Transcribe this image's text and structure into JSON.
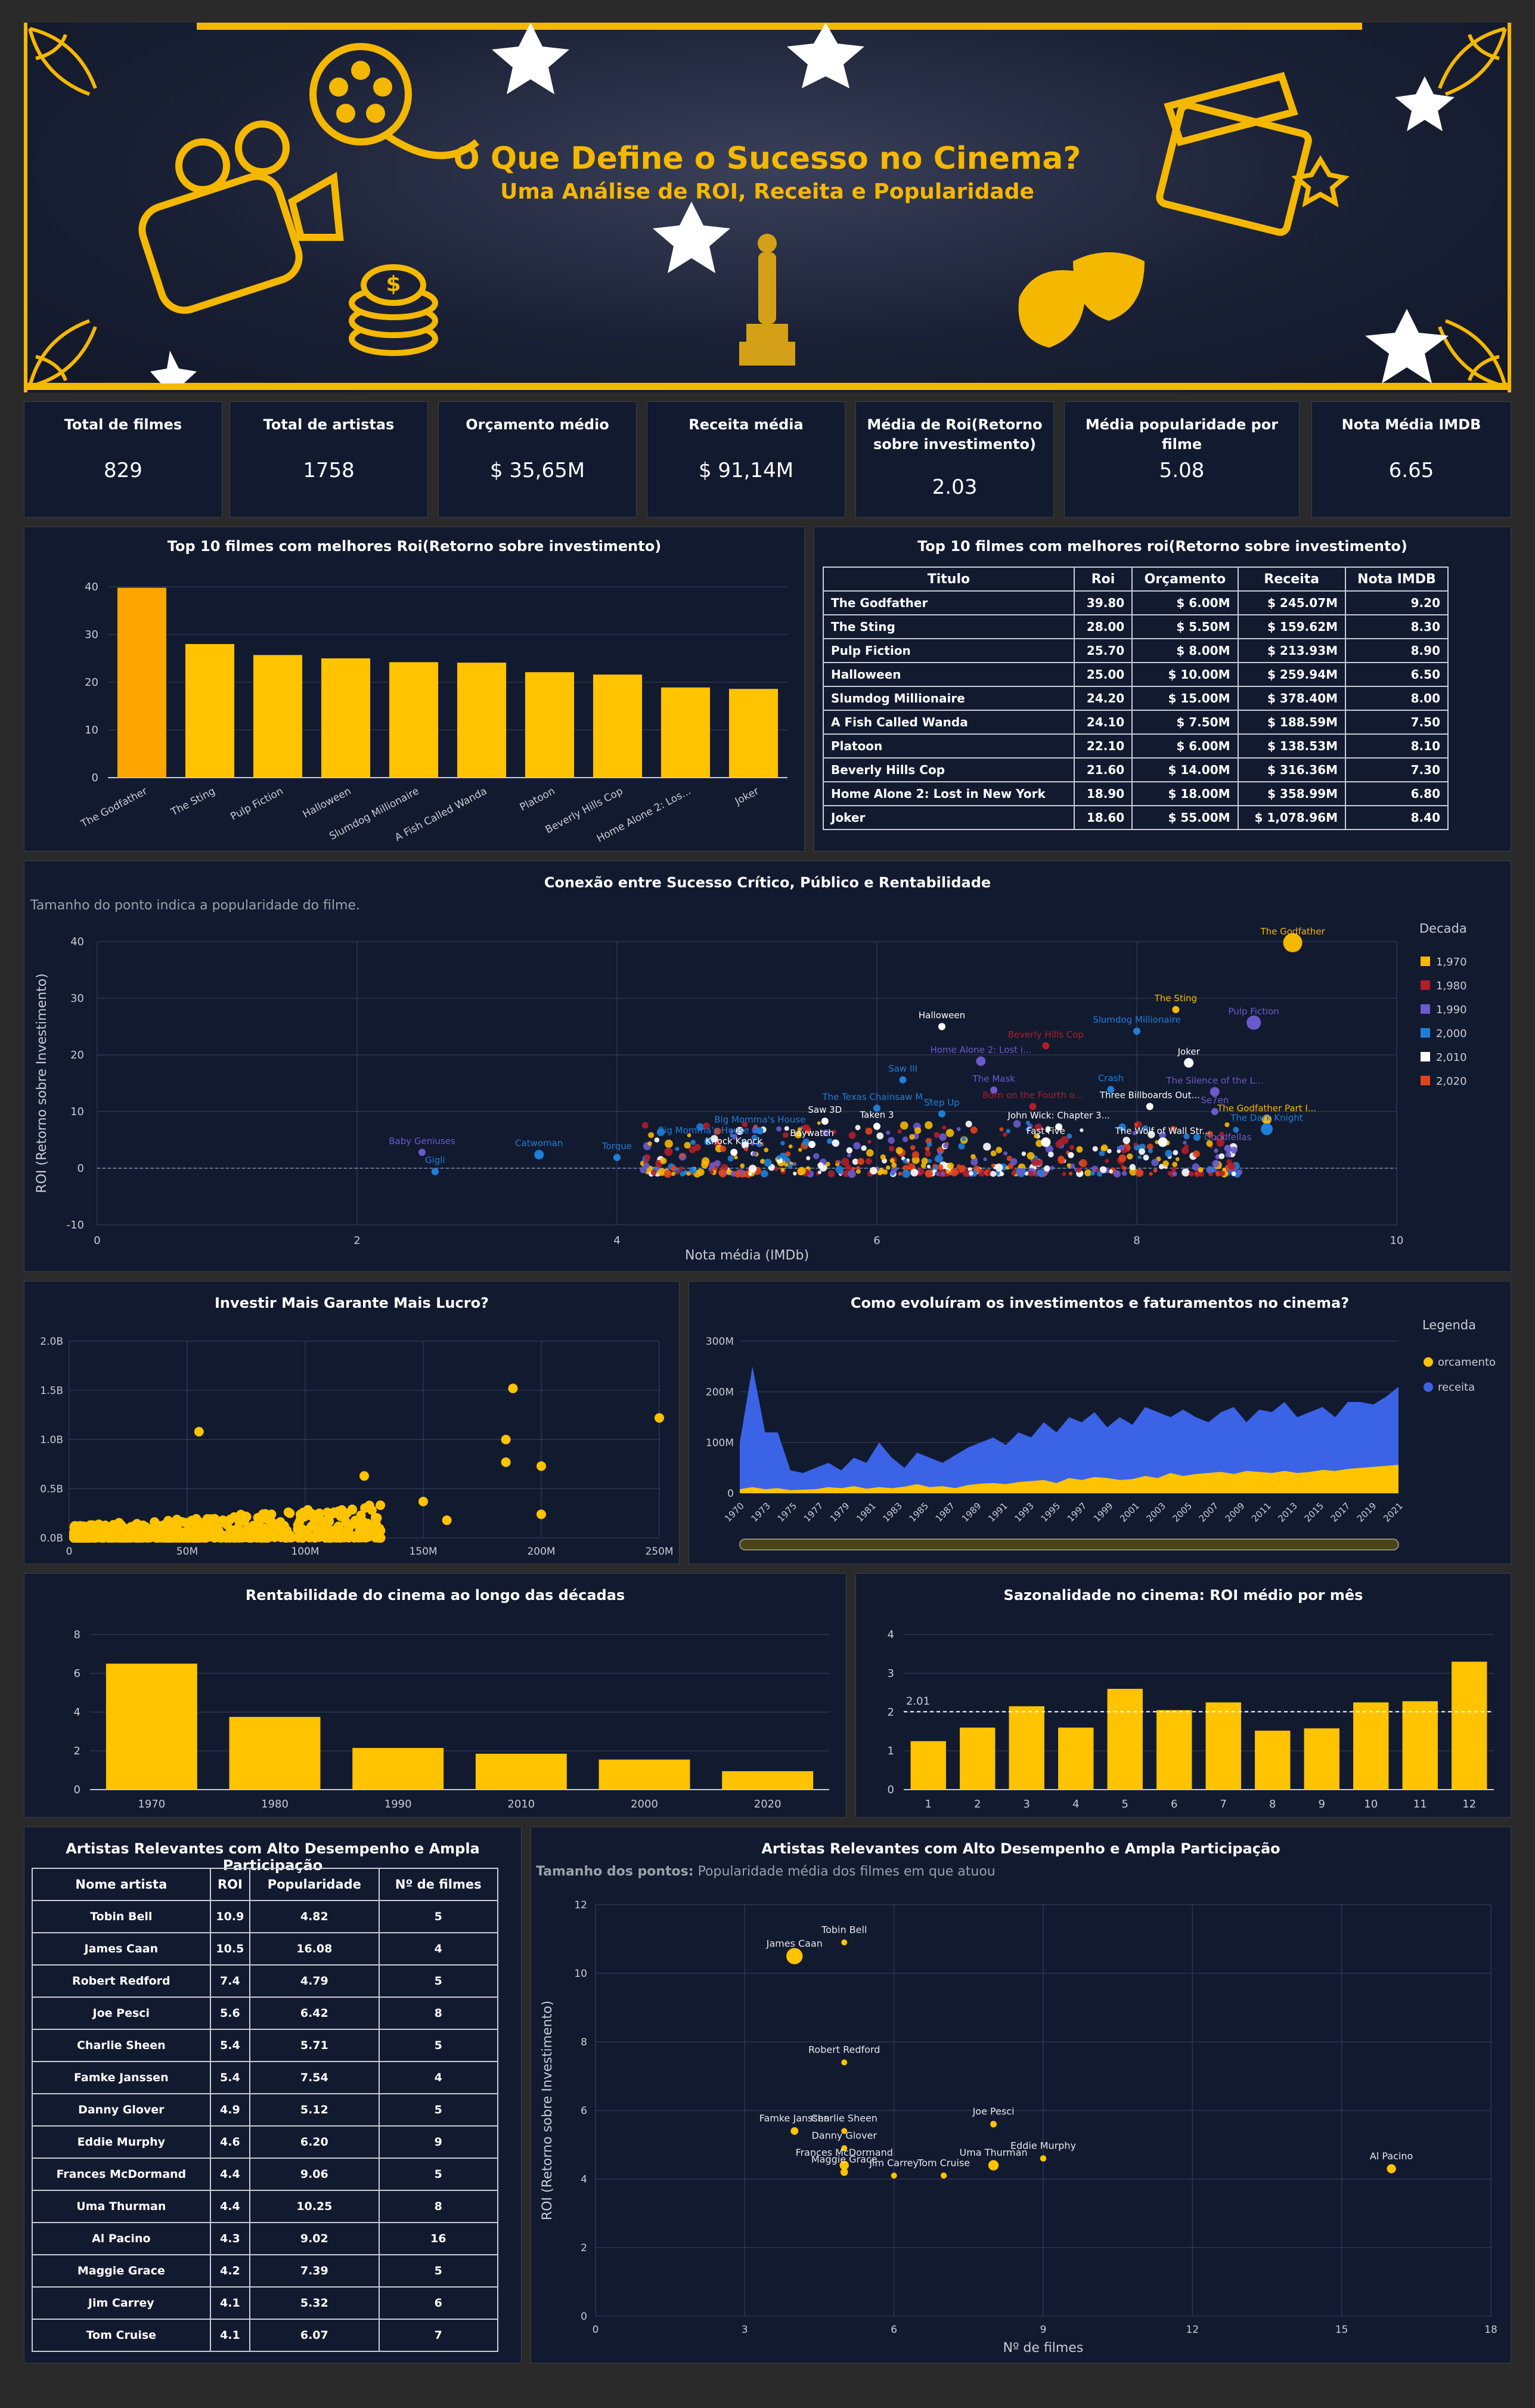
{
  "banner": {
    "title": "O Que Define o Sucesso no Cinema?",
    "subtitle": "Uma Análise de ROI, Receita e Popularidade"
  },
  "kpis": [
    {
      "label": "Total de filmes",
      "value": "829"
    },
    {
      "label": "Total de artistas",
      "value": "1758"
    },
    {
      "label": "Orçamento médio",
      "value": "$ 35,65M"
    },
    {
      "label": "Receita média",
      "value": "$ 91,14M"
    },
    {
      "label": "Média de Roi(Retorno sobre investimento)",
      "value": "2.03"
    },
    {
      "label": "Média popularidade por filme",
      "value": "5.08"
    },
    {
      "label": "Nota Média IMDB",
      "value": "6.65"
    }
  ],
  "top_roi_chart": {
    "title": "Top 10 filmes com melhores Roi(Retorno sobre investimento)"
  },
  "top_roi_table": {
    "title": "Top 10 filmes com melhores roi(Retorno sobre investimento)",
    "headers": [
      "Titulo",
      "Roi",
      "Orçamento",
      "Receita",
      "Nota IMDB"
    ],
    "rows": [
      [
        "The Godfather",
        "39.80",
        "$ 6.00M",
        "$ 245.07M",
        "9.20"
      ],
      [
        "The Sting",
        "28.00",
        "$ 5.50M",
        "$ 159.62M",
        "8.30"
      ],
      [
        "Pulp Fiction",
        "25.70",
        "$ 8.00M",
        "$ 213.93M",
        "8.90"
      ],
      [
        "Halloween",
        "25.00",
        "$ 10.00M",
        "$ 259.94M",
        "6.50"
      ],
      [
        "Slumdog Millionaire",
        "24.20",
        "$ 15.00M",
        "$ 378.40M",
        "8.00"
      ],
      [
        "A Fish Called Wanda",
        "24.10",
        "$ 7.50M",
        "$ 188.59M",
        "7.50"
      ],
      [
        "Platoon",
        "22.10",
        "$ 6.00M",
        "$ 138.53M",
        "8.10"
      ],
      [
        "Beverly Hills Cop",
        "21.60",
        "$ 14.00M",
        "$ 316.36M",
        "7.30"
      ],
      [
        "Home Alone 2: Lost in New York",
        "18.90",
        "$ 18.00M",
        "$ 358.99M",
        "6.80"
      ],
      [
        "Joker",
        "18.60",
        "$ 55.00M",
        "$ 1,078.96M",
        "8.40"
      ]
    ]
  },
  "scatter_imdb": {
    "title": "Conexão entre Sucesso Crítico, Público e Rentabilidade",
    "subtitle": "Tamanho do ponto indica a popularidade do filme.",
    "legend_title": "Decada",
    "legend": [
      "1,970",
      "1,980",
      "1,990",
      "2,000",
      "2,010",
      "2,020"
    ],
    "colors": [
      "#f5b800",
      "#b01e2a",
      "#6a5acd",
      "#1e7fd8",
      "#ffffff",
      "#e0441b"
    ]
  },
  "budget_chart": {
    "title": "Investir Mais Garante Mais Lucro?"
  },
  "area_chart": {
    "title": "Como evoluíram os investimentos e faturamentos no cinema?",
    "legend_title": "Legenda",
    "legend": [
      "orcamento",
      "receita"
    ]
  },
  "decade_chart": {
    "title": "Rentabilidade do cinema ao longo das décadas"
  },
  "month_chart": {
    "title": "Sazonalidade no cinema: ROI médio por mês",
    "avg_label": "2.01"
  },
  "artists_table": {
    "title": "Artistas Relevantes com Alto Desempenho e Ampla Participação",
    "headers": [
      "Nome artista",
      "ROI",
      "Popularidade",
      "Nº de filmes"
    ],
    "rows": [
      [
        "Tobin Bell",
        "10.9",
        "4.82",
        "5"
      ],
      [
        "James Caan",
        "10.5",
        "16.08",
        "4"
      ],
      [
        "Robert Redford",
        "7.4",
        "4.79",
        "5"
      ],
      [
        "Joe Pesci",
        "5.6",
        "6.42",
        "8"
      ],
      [
        "Charlie Sheen",
        "5.4",
        "5.71",
        "5"
      ],
      [
        "Famke Janssen",
        "5.4",
        "7.54",
        "4"
      ],
      [
        "Danny Glover",
        "4.9",
        "5.12",
        "5"
      ],
      [
        "Eddie Murphy",
        "4.6",
        "6.20",
        "9"
      ],
      [
        "Frances McDormand",
        "4.4",
        "9.06",
        "5"
      ],
      [
        "Uma Thurman",
        "4.4",
        "10.25",
        "8"
      ],
      [
        "Al Pacino",
        "4.3",
        "9.02",
        "16"
      ],
      [
        "Maggie Grace",
        "4.2",
        "7.39",
        "5"
      ],
      [
        "Jim Carrey",
        "4.1",
        "5.32",
        "6"
      ],
      [
        "Tom Cruise",
        "4.1",
        "6.07",
        "7"
      ]
    ]
  },
  "artists_scatter": {
    "title": "Artistas Relevantes com Alto Desempenho e Ampla Participação",
    "subtitle_bold": "Tamanho dos pontos:",
    "subtitle": "Popularidade média dos filmes em que atuou"
  },
  "chart_data": [
    {
      "type": "bar",
      "title": "Top 10 filmes com melhores Roi(Retorno sobre investimento)",
      "categories": [
        "The Godfather",
        "The Sting",
        "Pulp Fiction",
        "Halloween",
        "Slumdog Millionaire",
        "A Fish Called Wanda",
        "Platoon",
        "Beverly Hills Cop",
        "Home Alone 2: Los...",
        "Joker"
      ],
      "values": [
        39.8,
        28.0,
        25.7,
        25.0,
        24.2,
        24.1,
        22.1,
        21.6,
        18.9,
        18.6
      ],
      "ylim": [
        0,
        40
      ],
      "yticks": [
        0,
        10,
        20,
        30,
        40
      ]
    },
    {
      "type": "scatter",
      "title": "Conexão entre Sucesso Crítico, Público e Rentabilidade",
      "xlabel": "Nota média (IMDb)",
      "ylabel": "ROI (Retorno sobre Investimento)",
      "xlim": [
        0,
        10
      ],
      "ylim": [
        -10,
        40
      ],
      "xticks": [
        0,
        2,
        4,
        6,
        8,
        10
      ],
      "yticks": [
        -10,
        0,
        10,
        20,
        30,
        40
      ],
      "labeled_points": [
        {
          "name": "The Godfather",
          "x": 9.2,
          "y": 39.8,
          "pop": 6,
          "dec": 0
        },
        {
          "name": "The Sting",
          "x": 8.3,
          "y": 28.0,
          "pop": 1,
          "dec": 0
        },
        {
          "name": "Pulp Fiction",
          "x": 8.9,
          "y": 25.7,
          "pop": 4,
          "dec": 2
        },
        {
          "name": "Halloween",
          "x": 6.5,
          "y": 25.0,
          "pop": 1,
          "dec": 4
        },
        {
          "name": "Slumdog Millionaire",
          "x": 8.0,
          "y": 24.2,
          "pop": 1,
          "dec": 3
        },
        {
          "name": "Beverly Hills Cop",
          "x": 7.3,
          "y": 21.6,
          "pop": 1,
          "dec": 1
        },
        {
          "name": "Home Alone 2: Lost i...",
          "x": 6.8,
          "y": 18.9,
          "pop": 2,
          "dec": 2
        },
        {
          "name": "Joker",
          "x": 8.4,
          "y": 18.6,
          "pop": 2,
          "dec": 4
        },
        {
          "name": "Saw III",
          "x": 6.2,
          "y": 15.6,
          "pop": 1,
          "dec": 3
        },
        {
          "name": "The Mask",
          "x": 6.9,
          "y": 13.8,
          "pop": 1,
          "dec": 2
        },
        {
          "name": "Crash",
          "x": 7.8,
          "y": 13.9,
          "pop": 1,
          "dec": 3
        },
        {
          "name": "The Silence of the L...",
          "x": 8.6,
          "y": 13.5,
          "pop": 2,
          "dec": 2
        },
        {
          "name": "The Texas Chainsaw M...",
          "x": 6.0,
          "y": 10.6,
          "pop": 1,
          "dec": 3
        },
        {
          "name": "Step Up",
          "x": 6.5,
          "y": 9.6,
          "pop": 1,
          "dec": 3
        },
        {
          "name": "Born on the Fourth o...",
          "x": 7.2,
          "y": 10.9,
          "pop": 1,
          "dec": 1
        },
        {
          "name": "Three Billboards Out...",
          "x": 8.1,
          "y": 10.9,
          "pop": 1,
          "dec": 4
        },
        {
          "name": "Se7en",
          "x": 8.6,
          "y": 10.0,
          "pop": 1,
          "dec": 2
        },
        {
          "name": "Saw 3D",
          "x": 5.6,
          "y": 8.3,
          "pop": 1,
          "dec": 4
        },
        {
          "name": "Taken 3",
          "x": 6.0,
          "y": 7.4,
          "pop": 1,
          "dec": 4
        },
        {
          "name": "John Wick: Chapter 3...",
          "x": 7.4,
          "y": 7.3,
          "pop": 1,
          "dec": 4
        },
        {
          "name": "The Godfather Part I...",
          "x": 9.0,
          "y": 8.6,
          "pop": 2,
          "dec": 0
        },
        {
          "name": "The Dark Knight",
          "x": 9.0,
          "y": 6.9,
          "pop": 3,
          "dec": 3
        },
        {
          "name": "Big Momma's House",
          "x": 5.1,
          "y": 6.6,
          "pop": 1,
          "dec": 3
        },
        {
          "name": "Big Momma's House 2",
          "x": 4.7,
          "y": 4.7,
          "pop": 1,
          "dec": 3
        },
        {
          "name": "Knock Knock",
          "x": 4.9,
          "y": 2.8,
          "pop": 1,
          "dec": 4
        },
        {
          "name": "Baywatch",
          "x": 5.5,
          "y": 4.2,
          "pop": 1,
          "dec": 4
        },
        {
          "name": "Fast Five",
          "x": 7.3,
          "y": 4.6,
          "pop": 2,
          "dec": 4
        },
        {
          "name": "The Wolf of Wall Str...",
          "x": 8.2,
          "y": 4.6,
          "pop": 2,
          "dec": 4
        },
        {
          "name": "Goodfellas",
          "x": 8.7,
          "y": 3.5,
          "pop": 1,
          "dec": 2
        },
        {
          "name": "Torque",
          "x": 4.0,
          "y": 1.9,
          "pop": 1,
          "dec": 3
        },
        {
          "name": "Catwoman",
          "x": 3.4,
          "y": 2.4,
          "pop": 2,
          "dec": 3
        },
        {
          "name": "Baby Geniuses",
          "x": 2.5,
          "y": 2.8,
          "pop": 1,
          "dec": 2
        },
        {
          "name": "Gigli",
          "x": 2.6,
          "y": -0.6,
          "pop": 1,
          "dec": 3
        }
      ]
    },
    {
      "type": "scatter",
      "title": "Investir Mais Garante Mais Lucro?",
      "xticklabels": [
        "0",
        "50M",
        "100M",
        "150M",
        "200M",
        "250M"
      ],
      "yticklabels": [
        "0.0B",
        "0.5B",
        "1.0B",
        "1.5B",
        "2.0B"
      ],
      "xlim": [
        0,
        250
      ],
      "ylim": [
        0,
        2.0
      ],
      "highlight_points": [
        [
          55,
          1.08
        ],
        [
          188,
          1.52
        ],
        [
          185,
          1.0
        ],
        [
          200,
          0.73
        ],
        [
          185,
          0.77
        ],
        [
          250,
          1.22
        ],
        [
          200,
          0.24
        ],
        [
          125,
          0.63
        ],
        [
          160,
          0.18
        ],
        [
          150,
          0.37
        ]
      ]
    },
    {
      "type": "area",
      "title": "Como evoluíram os investimentos e faturamentos no cinema?",
      "years": [
        1970,
        1971,
        1972,
        1973,
        1974,
        1975,
        1976,
        1977,
        1978,
        1979,
        1980,
        1981,
        1982,
        1983,
        1984,
        1985,
        1986,
        1987,
        1988,
        1989,
        1990,
        1991,
        1992,
        1993,
        1994,
        1995,
        1996,
        1997,
        1998,
        1999,
        2000,
        2001,
        2002,
        2003,
        2004,
        2005,
        2006,
        2007,
        2008,
        2009,
        2010,
        2011,
        2012,
        2013,
        2014,
        2015,
        2016,
        2017,
        2018,
        2019,
        2020,
        2021,
        2022
      ],
      "series": [
        {
          "name": "orcamento",
          "values": [
            8,
            12,
            8,
            10,
            6,
            7,
            8,
            12,
            10,
            14,
            9,
            12,
            10,
            13,
            18,
            12,
            14,
            10,
            16,
            19,
            20,
            18,
            22,
            24,
            26,
            20,
            30,
            26,
            32,
            30,
            26,
            28,
            34,
            30,
            40,
            34,
            38,
            40,
            42,
            38,
            44,
            42,
            40,
            44,
            40,
            42,
            46,
            44,
            48,
            50,
            52,
            54,
            56
          ]
        },
        {
          "name": "receita",
          "values": [
            100,
            250,
            120,
            120,
            45,
            40,
            50,
            60,
            45,
            70,
            60,
            100,
            70,
            50,
            80,
            70,
            60,
            75,
            90,
            100,
            110,
            95,
            120,
            110,
            140,
            120,
            150,
            140,
            160,
            130,
            150,
            135,
            170,
            160,
            150,
            165,
            150,
            140,
            160,
            170,
            140,
            165,
            160,
            180,
            150,
            160,
            170,
            150,
            180,
            180,
            175,
            190,
            210
          ]
        }
      ],
      "ylim": [
        0,
        300
      ],
      "yticklabels": [
        "0",
        "100M",
        "200M",
        "300M"
      ],
      "xticklabels": [
        "1970",
        "1973",
        "1975",
        "1977",
        "1979",
        "1981",
        "1983",
        "1985",
        "1987",
        "1989",
        "1991",
        "1993",
        "1995",
        "1997",
        "1999",
        "2001",
        "2003",
        "2005",
        "2007",
        "2009",
        "2011",
        "2013",
        "2015",
        "2017",
        "2019",
        "2021"
      ]
    },
    {
      "type": "bar",
      "title": "Rentabilidade do cinema ao longo das décadas",
      "categories": [
        "1970",
        "1980",
        "1990",
        "2010",
        "2000",
        "2020"
      ],
      "values": [
        6.5,
        3.75,
        2.15,
        1.85,
        1.55,
        0.95
      ],
      "ylim": [
        0,
        8
      ],
      "yticks": [
        0,
        2,
        4,
        6,
        8
      ]
    },
    {
      "type": "bar",
      "title": "Sazonalidade no cinema: ROI médio por mês",
      "categories": [
        "1",
        "2",
        "3",
        "4",
        "5",
        "6",
        "7",
        "8",
        "9",
        "10",
        "11",
        "12"
      ],
      "values": [
        1.25,
        1.6,
        2.15,
        1.6,
        2.6,
        2.05,
        2.25,
        1.52,
        1.58,
        2.25,
        2.28,
        3.3
      ],
      "ylim": [
        0,
        4
      ],
      "yticks": [
        0,
        1,
        2,
        3,
        4
      ],
      "avg": 2.01
    },
    {
      "type": "scatter",
      "title": "Artistas Relevantes com Alto Desempenho e Ampla Participação",
      "xlabel": "Nº de filmes",
      "ylabel": "ROI (Retorno sobre Investimento)",
      "xlim": [
        0,
        18
      ],
      "ylim": [
        0,
        12
      ],
      "xticks": [
        0,
        3,
        6,
        9,
        12,
        15,
        18
      ],
      "yticks": [
        0,
        2,
        4,
        6,
        8,
        10,
        12
      ],
      "points": [
        {
          "name": "Tobin Bell",
          "x": 5,
          "y": 10.9,
          "pop": 4.82
        },
        {
          "name": "James Caan",
          "x": 4,
          "y": 10.5,
          "pop": 16.08
        },
        {
          "name": "Robert Redford",
          "x": 5,
          "y": 7.4,
          "pop": 4.79
        },
        {
          "name": "Joe Pesci",
          "x": 8,
          "y": 5.6,
          "pop": 6.42
        },
        {
          "name": "Charlie Sheen",
          "x": 5,
          "y": 5.4,
          "pop": 5.71
        },
        {
          "name": "Famke Janssen",
          "x": 4,
          "y": 5.4,
          "pop": 7.54
        },
        {
          "name": "Danny Glover",
          "x": 5,
          "y": 4.9,
          "pop": 5.12
        },
        {
          "name": "Eddie Murphy",
          "x": 9,
          "y": 4.6,
          "pop": 6.2
        },
        {
          "name": "Frances McDormand",
          "x": 5,
          "y": 4.4,
          "pop": 9.06
        },
        {
          "name": "Uma Thurman",
          "x": 8,
          "y": 4.4,
          "pop": 10.25
        },
        {
          "name": "Al Pacino",
          "x": 16,
          "y": 4.3,
          "pop": 9.02
        },
        {
          "name": "Maggie Grace",
          "x": 5,
          "y": 4.2,
          "pop": 7.39
        },
        {
          "name": "Jim Carrey",
          "x": 6,
          "y": 4.1,
          "pop": 5.32
        },
        {
          "name": "Tom Cruise",
          "x": 7,
          "y": 4.1,
          "pop": 6.07
        }
      ]
    }
  ]
}
